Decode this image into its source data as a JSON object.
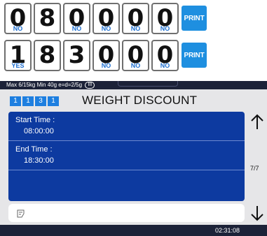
{
  "rows": [
    {
      "keys": [
        {
          "digit": "0",
          "sub": "NO"
        },
        {
          "digit": "8",
          "sub": ""
        },
        {
          "digit": "0",
          "sub": "NO"
        },
        {
          "digit": "0",
          "sub": "NO"
        },
        {
          "digit": "0",
          "sub": "NO"
        },
        {
          "digit": "0",
          "sub": "NO"
        }
      ],
      "print_label": "PRINT"
    },
    {
      "keys": [
        {
          "digit": "1",
          "sub": "YES"
        },
        {
          "digit": "8",
          "sub": ""
        },
        {
          "digit": "3",
          "sub": ""
        },
        {
          "digit": "0",
          "sub": "NO"
        },
        {
          "digit": "0",
          "sub": "NO"
        },
        {
          "digit": "0",
          "sub": "NO"
        }
      ],
      "print_label": "PRINT"
    }
  ],
  "status": {
    "spec": "Max 6/15kg Min 40g e=d=2/5g",
    "range": "III"
  },
  "header": {
    "codes": [
      "1",
      "1",
      "3",
      "1"
    ],
    "title": "WEIGHT DISCOUNT"
  },
  "fields": [
    {
      "label": "Start Time :",
      "value": "08:00:00"
    },
    {
      "label": "End  Time :",
      "value": "18:30:00"
    }
  ],
  "page_indicator": "7/7",
  "clock": "02:31:08",
  "icons": {
    "up": "arrow-up-icon",
    "down": "arrow-down-icon",
    "input": "edit-note-icon"
  },
  "colors": {
    "accent": "#1e8fe0",
    "panel": "#0d3aa0",
    "bar": "#1c2238",
    "sub_label": "#1e6fd0"
  }
}
